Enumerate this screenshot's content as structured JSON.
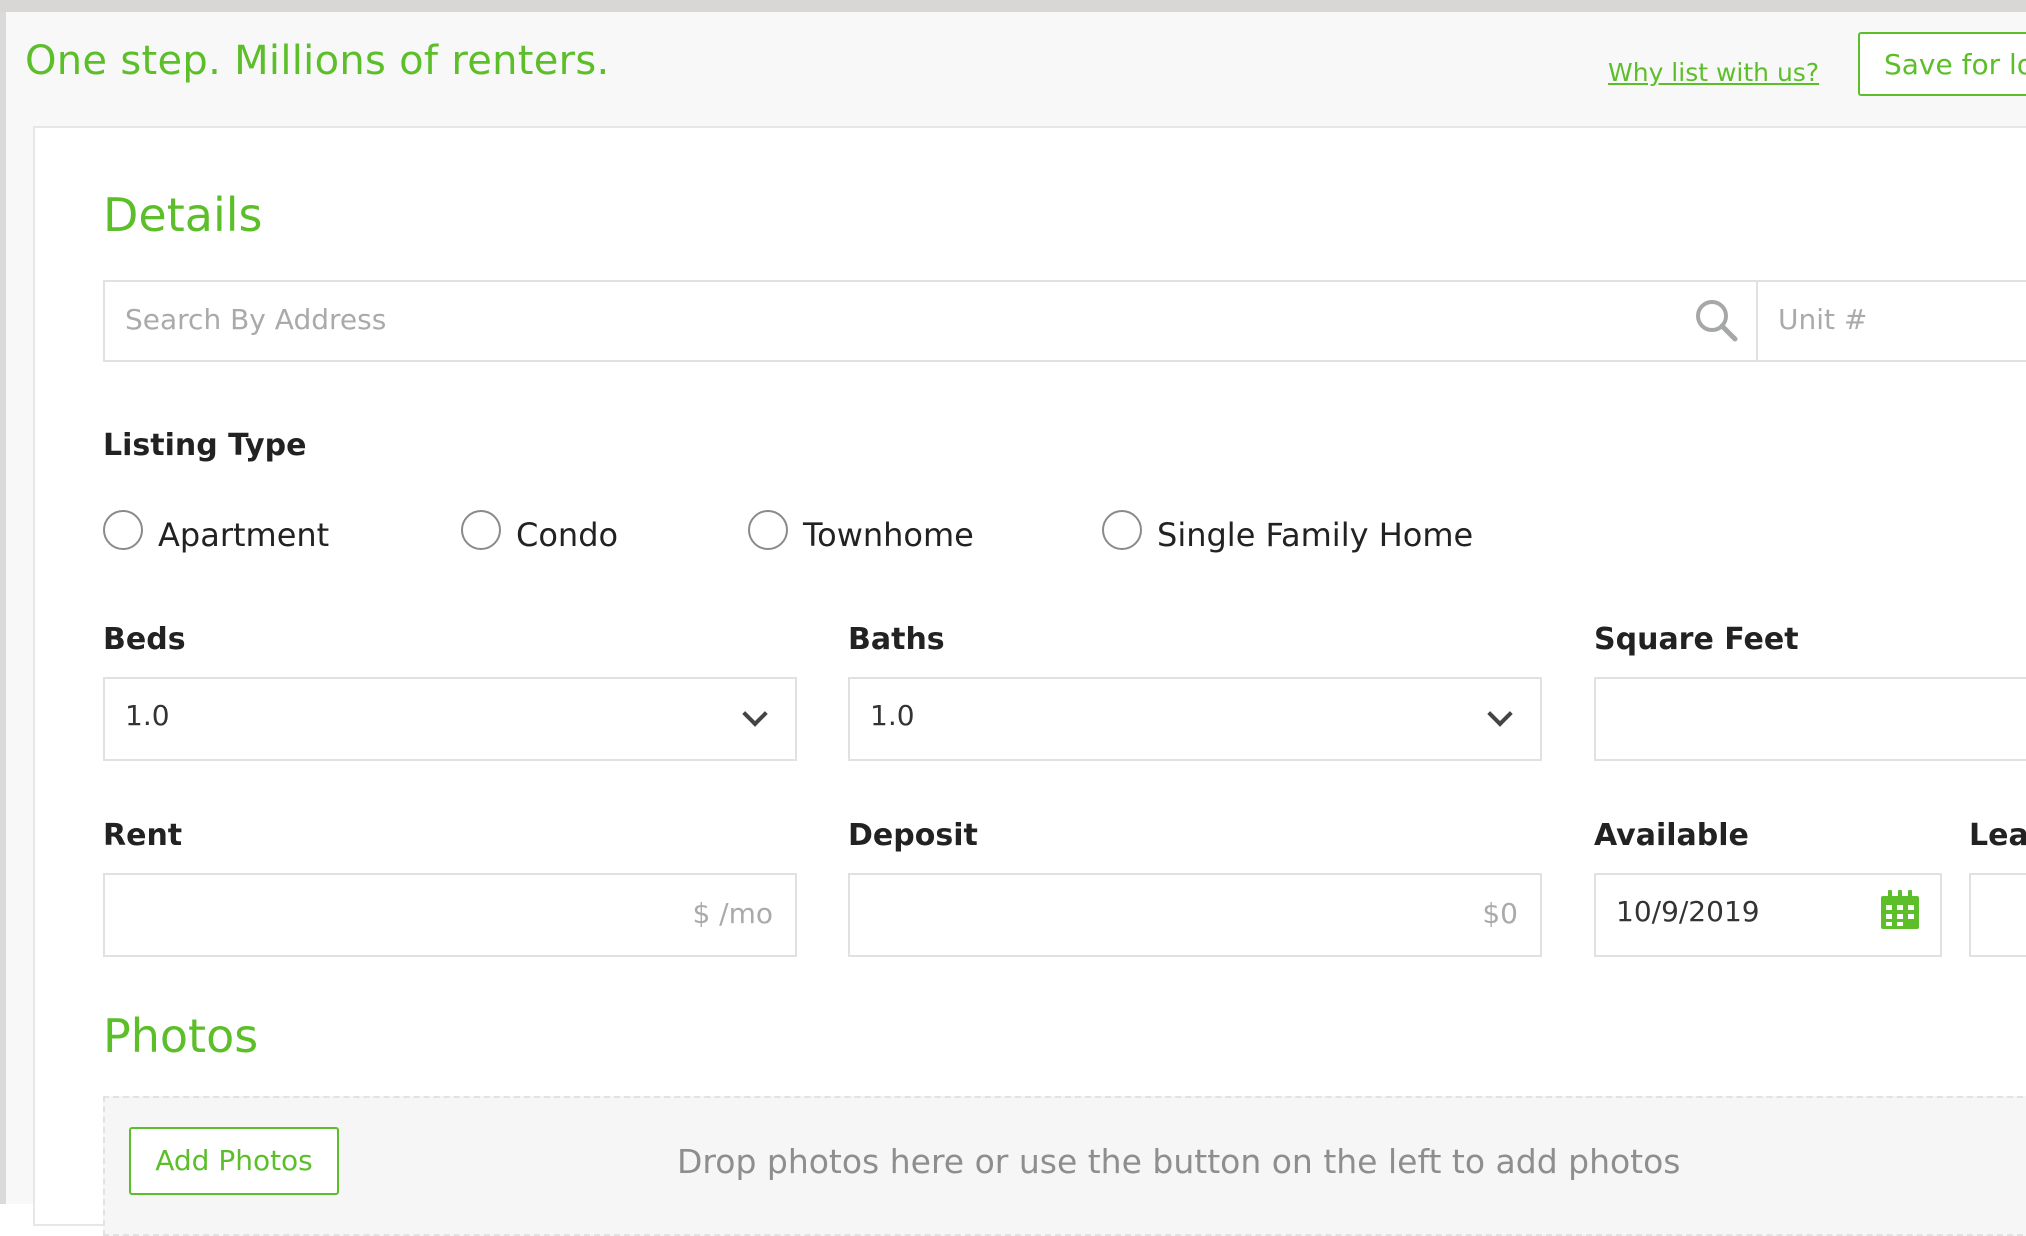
{
  "header": {
    "tagline": "One step. Millions of renters.",
    "why_link": "Why list with us?",
    "save_button": "Save for lo"
  },
  "details": {
    "title": "Details",
    "address_placeholder": "Search By Address",
    "unit_placeholder": "Unit #",
    "listing_type_label": "Listing Type",
    "listing_types": [
      "Apartment",
      "Condo",
      "Townhome",
      "Single Family Home"
    ],
    "beds_label": "Beds",
    "beds_value": "1.0",
    "baths_label": "Baths",
    "baths_value": "1.0",
    "sqft_label": "Square Feet",
    "rent_label": "Rent",
    "rent_placeholder": "$ /mo",
    "deposit_label": "Deposit",
    "deposit_placeholder": "$0",
    "available_label": "Available",
    "available_value": "10/9/2019",
    "lease_label": "Leas"
  },
  "photos": {
    "title": "Photos",
    "add_button": "Add Photos",
    "drop_text": "Drop photos here or use the button on the left to add photos"
  },
  "colors": {
    "brand_green": "#5cbf2a",
    "border_grey": "#e0e2e0"
  },
  "icons": [
    "search-icon",
    "chevron-down-icon",
    "calendar-icon"
  ]
}
